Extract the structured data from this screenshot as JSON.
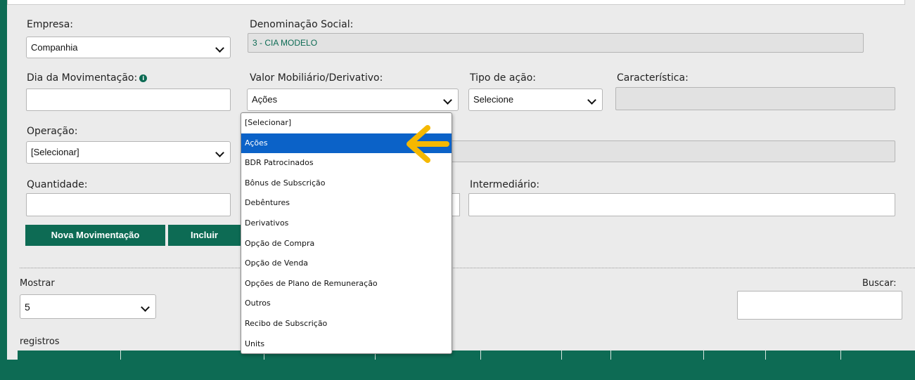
{
  "form": {
    "empresa_label": "Empresa:",
    "empresa_value": "Companhia",
    "denominacao_label": "Denominação Social:",
    "denominacao_value": "3 - CIA MODELO",
    "dia_label": "Dia da Movimentação:",
    "info_glyph": "i",
    "valor_label": "Valor Mobiliário/Derivativo:",
    "valor_value": "Ações",
    "tipo_label": "Tipo de ação:",
    "tipo_value": "Selecione",
    "caracteristica_label": "Característica:",
    "operacao_label": "Operação:",
    "operacao_value": "[Selecionar]",
    "quantidade_label": "Quantidade:",
    "intermediario_label": "Intermediário:"
  },
  "buttons": {
    "nova": "Nova Movimentação",
    "incluir": "Incluir"
  },
  "table_controls": {
    "mostrar_label": "Mostrar",
    "mostrar_value": "5",
    "registros_label": "registros",
    "buscar_label": "Buscar:"
  },
  "dropdown": {
    "selected": "Ações",
    "options": [
      "[Selecionar]",
      "Ações",
      "BDR Patrocinados",
      "Bônus de Subscrição",
      "Debêntures",
      "Derivativos",
      "Opção de Compra",
      "Opção de Venda",
      "Opções de Plano de Remuneração",
      "Outros",
      "Recibo de Subscrição",
      "Units"
    ]
  },
  "colors": {
    "brand_green": "#0d6b54",
    "highlight_blue": "#0b62c8",
    "arrow_yellow": "#f5b800"
  }
}
